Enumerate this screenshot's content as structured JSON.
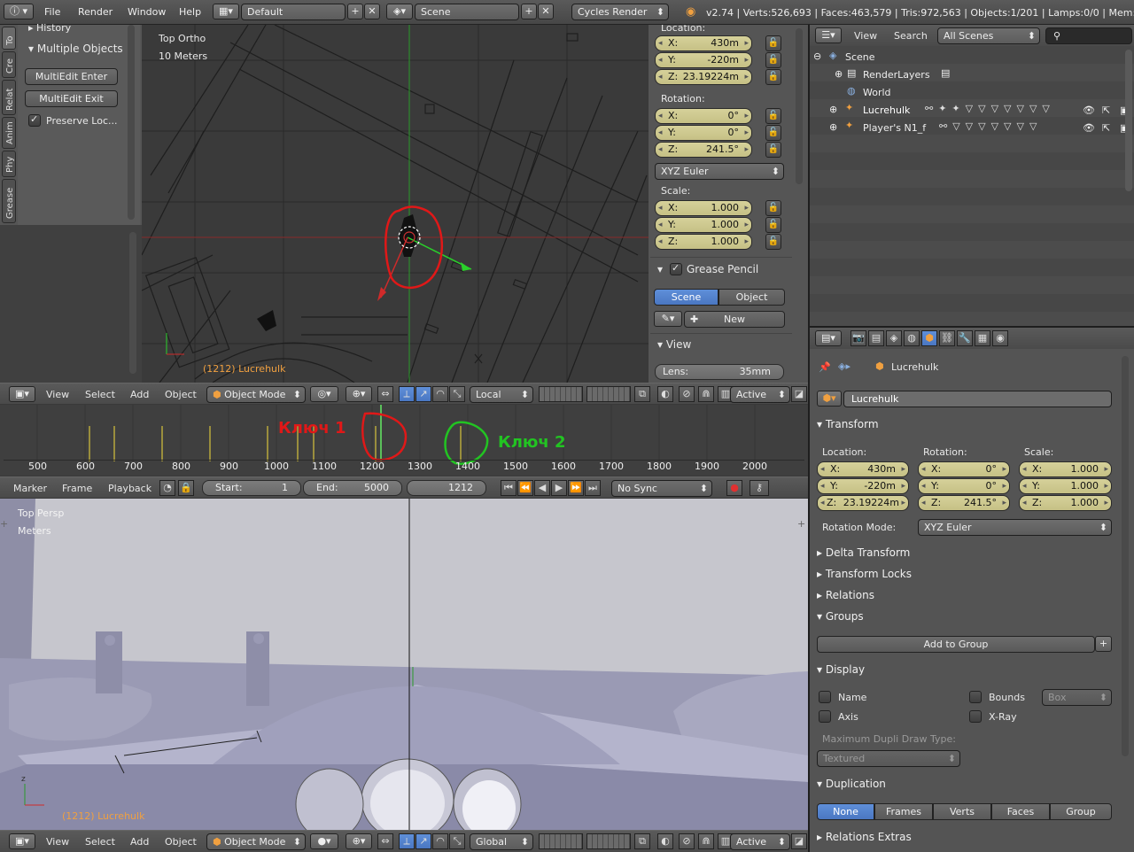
{
  "topbar": {
    "menus": [
      "File",
      "Render",
      "Window",
      "Help"
    ],
    "screen_layout": "Default",
    "scene": "Scene",
    "engine": "Cycles Render",
    "stats": "v2.74 | Verts:526,693 | Faces:463,579 | Tris:972,563 | Objects:1/201 | Lamps:0/0 | Mem:323."
  },
  "toolshelf": {
    "tabs": [
      "To",
      "Cre",
      "Relat",
      "Anim",
      "Phy",
      "Grease"
    ],
    "history_label": "History",
    "panel_title": "Multiple Objects",
    "btn_enter": "MultiEdit Enter",
    "btn_exit": "MultiEdit Exit",
    "preserve_label": "Preserve Loc..."
  },
  "viewport_top": {
    "view_name": "Top Ortho",
    "scale": "10 Meters",
    "object_info": "(1212) Lucrehulk"
  },
  "npanel": {
    "location_label": "Location:",
    "loc_x_label": "X:",
    "loc_x": "430m",
    "loc_y_label": "Y:",
    "loc_y": "-220m",
    "loc_z_label": "Z:",
    "loc_z": "23.19224m",
    "rotation_label": "Rotation:",
    "rot_x_label": "X:",
    "rot_x": "0°",
    "rot_y_label": "Y:",
    "rot_y": "0°",
    "rot_z_label": "Z:",
    "rot_z": "241.5°",
    "rot_mode": "XYZ Euler",
    "scale_label": "Scale:",
    "scl_x_label": "X:",
    "scl_x": "1.000",
    "scl_y_label": "Y:",
    "scl_y": "1.000",
    "scl_z_label": "Z:",
    "scl_z": "1.000",
    "grease_title": "Grease Pencil",
    "gp_scene": "Scene",
    "gp_object": "Object",
    "gp_new": "New",
    "view_title": "View",
    "lens_label": "Lens:",
    "lens_value": "35mm"
  },
  "header_top": {
    "view": "View",
    "select": "Select",
    "add": "Add",
    "object": "Object",
    "mode": "Object Mode",
    "orientation": "Local",
    "pivot": "Active"
  },
  "timeline": {
    "ticks": [
      "500",
      "600",
      "700",
      "800",
      "900",
      "1000",
      "1100",
      "1200",
      "1300",
      "1400",
      "1500",
      "1600",
      "1700",
      "1800",
      "1900",
      "2000"
    ],
    "key1": "Ключ 1",
    "key2": "Ключ 2",
    "marker": "Marker",
    "frame": "Frame",
    "playback": "Playback",
    "start_label": "Start:",
    "start": "1",
    "end_label": "End:",
    "end": "5000",
    "current": "1212",
    "sync": "No Sync"
  },
  "viewport_bottom": {
    "view_name": "Top Persp",
    "units": "Meters",
    "object_info": "(1212) Lucrehulk"
  },
  "header_bottom": {
    "view": "View",
    "select": "Select",
    "add": "Add",
    "object": "Object",
    "mode": "Object Mode",
    "orientation": "Global",
    "pivot": "Active"
  },
  "outliner": {
    "view": "View",
    "search": "Search",
    "filter": "All Scenes",
    "items": [
      "Scene",
      "RenderLayers",
      "World",
      "Lucrehulk",
      "Player's N1_f"
    ]
  },
  "properties": {
    "breadcrumb": "Lucrehulk",
    "object_name": "Lucrehulk",
    "transform_title": "Transform",
    "location_label": "Location:",
    "rotation_label": "Rotation:",
    "scale_label": "Scale:",
    "lx_label": "X:",
    "lx": "430m",
    "ly_label": "Y:",
    "ly": "-220m",
    "lz_label": "Z:",
    "lz": "23.19224m",
    "rx_label": "X:",
    "rx": "0°",
    "ry_label": "Y:",
    "ry": "0°",
    "rz_label": "Z:",
    "rz": "241.5°",
    "sx_label": "X:",
    "sx": "1.000",
    "sy_label": "Y:",
    "sy": "1.000",
    "sz_label": "Z:",
    "sz": "1.000",
    "rotation_mode_label": "Rotation Mode:",
    "rotation_mode": "XYZ Euler",
    "delta_transform": "Delta Transform",
    "transform_locks": "Transform Locks",
    "relations": "Relations",
    "groups": "Groups",
    "add_to_group": "Add to Group",
    "display": "Display",
    "name": "Name",
    "bounds": "Bounds",
    "bounds_type": "Box",
    "axis": "Axis",
    "xray": "X-Ray",
    "max_dupli_label": "Maximum Dupli Draw Type:",
    "dupli_type": "Textured",
    "duplication": "Duplication",
    "dup_none": "None",
    "dup_frames": "Frames",
    "dup_verts": "Verts",
    "dup_faces": "Faces",
    "dup_group": "Group",
    "relations_extras": "Relations Extras"
  }
}
